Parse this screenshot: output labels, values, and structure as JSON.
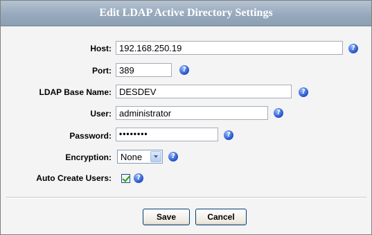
{
  "dialog": {
    "title": "Edit LDAP Active Directory Settings"
  },
  "form": {
    "host": {
      "label": "Host:",
      "value": "192.168.250.19"
    },
    "port": {
      "label": "Port:",
      "value": "389"
    },
    "base_name": {
      "label": "LDAP Base Name:",
      "value": "DESDEV"
    },
    "user": {
      "label": "User:",
      "value": "administrator"
    },
    "password": {
      "label": "Password:",
      "value": "••••••••"
    },
    "encryption": {
      "label": "Encryption:",
      "selected": "None"
    },
    "auto_create": {
      "label": "Auto Create Users:",
      "checked": true
    }
  },
  "help_icon_glyph": "?",
  "buttons": {
    "save_label": "Save",
    "cancel_label": "Cancel"
  }
}
